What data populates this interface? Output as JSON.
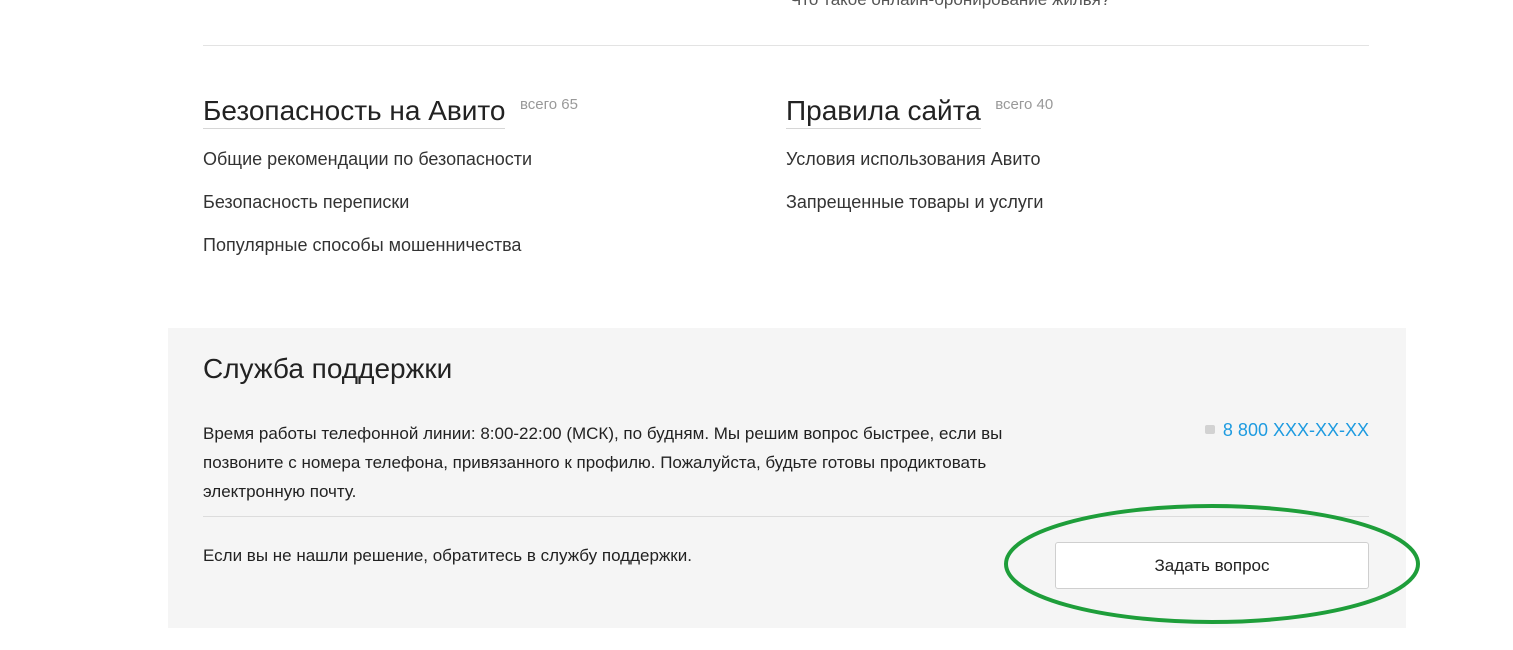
{
  "top_cut_link": "Что такое онлайн-бронирование жилья?",
  "sections": [
    {
      "title": "Безопасность на Авито",
      "count": "всего 65",
      "links": [
        "Общие рекомендации по безопасности",
        "Безопасность переписки",
        "Популярные способы мошенничества"
      ]
    },
    {
      "title": "Правила сайта",
      "count": "всего 40",
      "links": [
        "Условия использования Авито",
        "Запрещенные товары и услуги"
      ]
    }
  ],
  "support": {
    "title": "Служба поддержки",
    "hours_text": "Время работы телефонной линии: 8:00-22:00 (МСК), по будням. Мы решим вопрос быстрее, если вы позвоните с номера телефона, привязанного к профилю. Пожалуйста, будьте готовы продиктовать электронную почту.",
    "phone": "8 800 XXX-XX-XX",
    "phone_icon": "phone-icon",
    "contact_text": "Если вы не нашли решение, обратитесь в службу поддержки.",
    "ask_button_label": "Задать вопрос"
  },
  "colors": {
    "link_blue": "#1e9be0",
    "support_bg": "#f5f5f5",
    "highlight_green": "#1e9e3a"
  }
}
